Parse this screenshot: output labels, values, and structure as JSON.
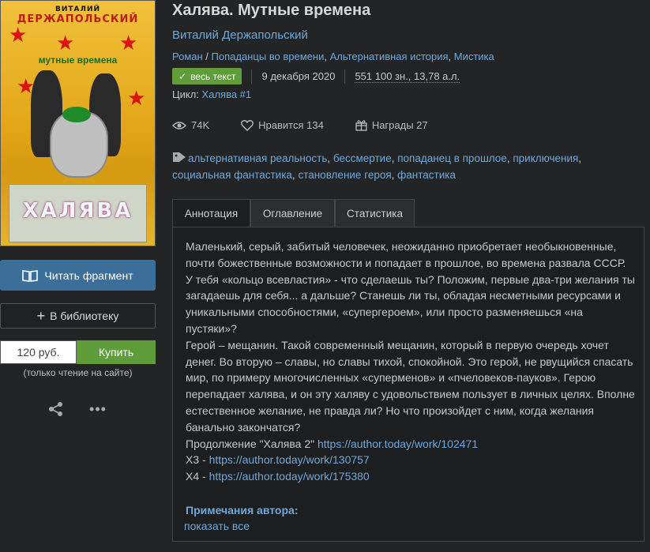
{
  "cover": {
    "author_top": "ВИТАЛИЙ",
    "author_name": "ДЕРЖАПОЛЬСКИЙ",
    "subtitle": "мутные времена",
    "bill_title": "ХАЛЯВА"
  },
  "sidebar": {
    "read_label": "Читать фрагмент",
    "library_label": "В библиотеку",
    "price": "120 руб.",
    "buy_label": "Купить",
    "note": "(только чтение на сайте)"
  },
  "book": {
    "title": "Халява. Мутные времена",
    "author": "Виталий Держапольский",
    "genres": [
      "Роман",
      "Попаданцы во времени",
      "Альтернативная история",
      "Мистика"
    ],
    "status_label": "весь текст",
    "date": "9 декабря 2020",
    "size": "551 100 зн., 13,78 а.л.",
    "cycle_label": "Цикл:",
    "cycle_link": "Халява #1"
  },
  "stats": {
    "views": "74K",
    "likes": "Нравится 134",
    "awards": "Награды 27"
  },
  "tags": [
    "альтернативная реальность",
    "бессмертие",
    "попаданец в прошлое",
    "приключения",
    "социальная фантастика",
    "становление героя",
    "фантастика"
  ],
  "tabs": [
    "Аннотация",
    "Оглавление",
    "Статистика"
  ],
  "annotation": {
    "p1": "Маленький, серый, забитый человечек, неожиданно приобретает необыкновенные, почти божественные возможности и попадает в прошлое, во времена развала СССР. У тебя «кольцо всевластия» - что сделаешь ты? Положим, первые два-три желания ты загадаешь для себя... а дальше? Станешь ли ты, обладая несметными ресурсами и уникальными способностями, «супергероем», или просто разменяешься «на пустяки»?",
    "p2": "Герой – мещанин. Такой современный мещанин, который в первую очередь хочет денег. Во вторую – славы, но славы тихой, спокойной. Это герой, не рвущийся спасать мир, по примеру многочисленных «суперменов» и «пчеловеков-пауков». Герою перепадает халява, и он эту халяву с удовольствием пользует в личных целях. Вполне естественное желание, не правда ли? Но что произойдет с ним, когда желания банально закончатся?",
    "cont_label": "Продолжение \"Халява 2\"",
    "cont_link": "https://author.today/work/102471",
    "x3_label": "Х3 -",
    "x3_link": "https://author.today/work/130757",
    "x4_label": "Х4 -",
    "x4_link": "https://author.today/work/175380",
    "notes_title": "Примечания автора:",
    "show_all": "показать все"
  },
  "colors": {
    "accent": "#6fa8dc",
    "green": "#5f9d3b",
    "read_button": "#3c6e9a",
    "background": "#222425"
  }
}
